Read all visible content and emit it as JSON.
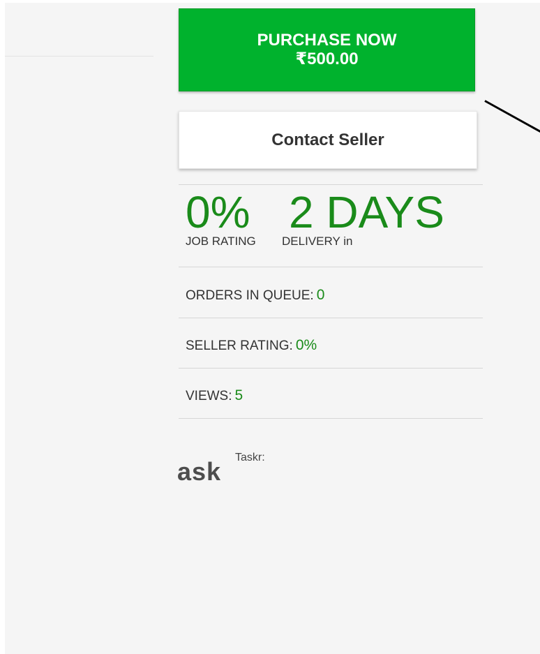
{
  "purchase": {
    "label": "PURCHASE NOW",
    "price": "₹500.00"
  },
  "contact": {
    "label": "Contact Seller"
  },
  "stats": {
    "job_rating_value": "0%",
    "job_rating_label": "JOB RATING",
    "delivery_value": "2 DAYS",
    "delivery_label": "DELIVERY in"
  },
  "info": {
    "orders_label": "ORDERS IN QUEUE:",
    "orders_value": "0",
    "seller_rating_label": "SELLER RATING:",
    "seller_rating_value": "0%",
    "views_label": "VIEWS:",
    "views_value": "5"
  },
  "seller": {
    "logo_text": "ask",
    "name_label": "Taskr:"
  },
  "colors": {
    "accent_green": "#00b22d",
    "stat_green": "#1a8b1a"
  }
}
